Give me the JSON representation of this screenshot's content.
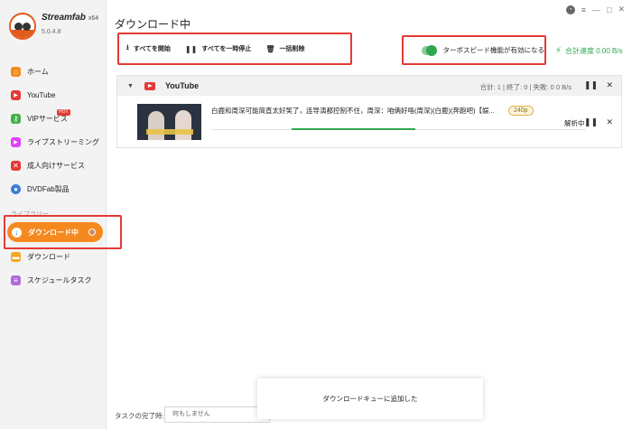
{
  "app": {
    "name": "Streamfab",
    "arch": "x64",
    "version": "5.0.4.8"
  },
  "sidebar": {
    "items": [
      {
        "label": "ホーム",
        "icon": "home-icon",
        "color": "#f5891f"
      },
      {
        "label": "YouTube",
        "icon": "youtube-icon",
        "color": "#e53935"
      },
      {
        "label": "VIPサービス",
        "icon": "vip-key-icon",
        "color": "#43b049",
        "badge": "HOT"
      },
      {
        "label": "ライブストリーミング",
        "icon": "live-stream-icon",
        "color": "#e040fb"
      },
      {
        "label": "成人向けサービス",
        "icon": "adult-service-icon",
        "color": "#e53935"
      },
      {
        "label": "DVDFab製品",
        "icon": "dvdfab-icon",
        "color": "#3a7bd5"
      }
    ],
    "library_label": "ライブラリー",
    "library_items": [
      {
        "label": "ダウンロード中",
        "icon": "download-arrow-icon",
        "color": "#f5891f"
      },
      {
        "label": "ダウンロード",
        "icon": "folder-icon",
        "color": "#f5a623"
      },
      {
        "label": "スケジュールタスク",
        "icon": "schedule-icon",
        "color": "#b06ad9"
      }
    ]
  },
  "header": {
    "title": "ダウンロード中"
  },
  "toolbar": {
    "start_all": "すべてを開始",
    "pause_all": "すべてを一時停止",
    "delete_all": "一括削除"
  },
  "turbo": {
    "label": "ターボスピード機能が有効になる",
    "enabled": true
  },
  "total_speed": "合計速度 0.00 B/s",
  "group": {
    "name": "YouTube",
    "stats": "合計: 1 | 終了: 0 | 失敗: 0    0 B/s"
  },
  "task": {
    "title": "白鹿和周深可能简直太好笑了，连导演都控制不住，周深：咱俩好咯(周深)(白鹿)(奔跑吧)【娱...",
    "quality": "240p",
    "status": "解析中",
    "progress": 0.33
  },
  "bottom": {
    "label": "タスクの完了時:",
    "select_value": "何もしません"
  },
  "toast": {
    "message": "ダウンロードキューに追加した"
  },
  "colors": {
    "accent": "#f5891f",
    "highlight": "#e53935",
    "success": "#2fa84f"
  }
}
